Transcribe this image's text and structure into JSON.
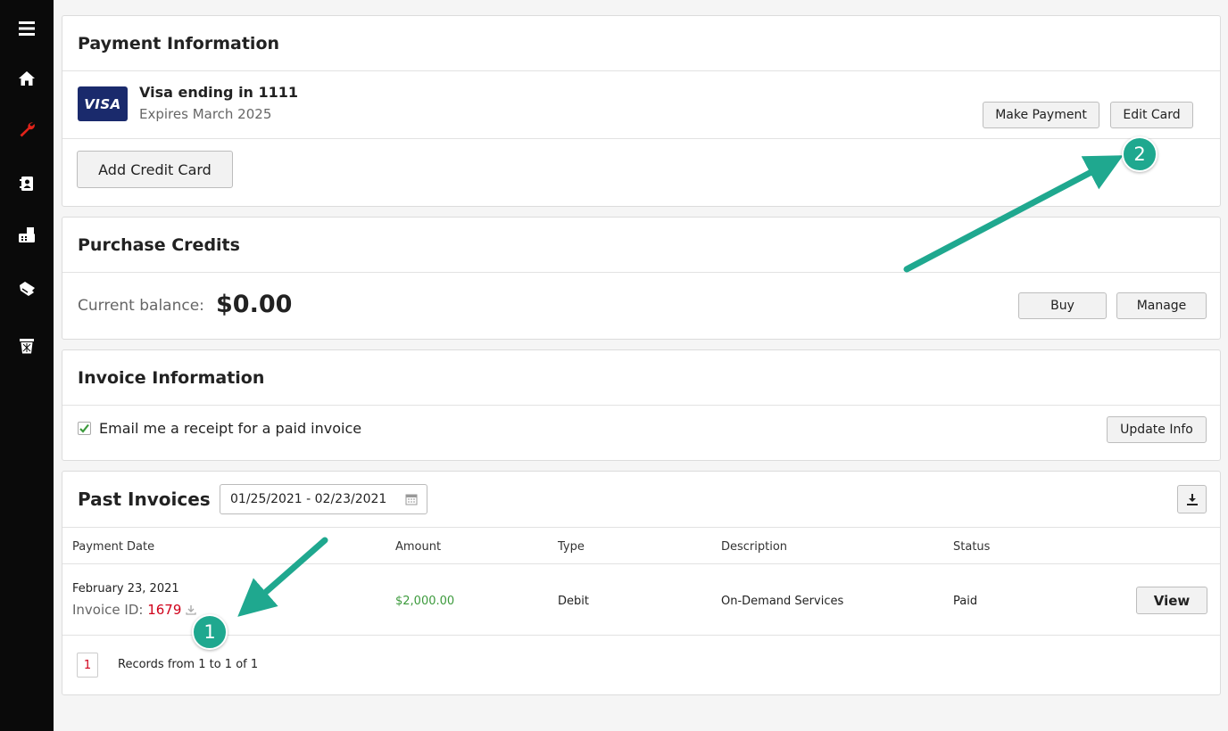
{
  "colors": {
    "accent": "#1fa88f",
    "invoice_id": "#d0021b",
    "amount": "#3c9a3c",
    "sidebar_bg": "#0a0a0a",
    "wrench": "#e2231a"
  },
  "sidebar": {
    "icons": [
      "menu-icon",
      "home-icon",
      "wrench-icon",
      "contacts-icon",
      "fax-icon",
      "handshake-icon",
      "trash-icon"
    ]
  },
  "payment": {
    "title": "Payment Information",
    "card_brand": "VISA",
    "card_name": "Visa ending in 1111",
    "card_expiry": "Expires March 2025",
    "make_payment_label": "Make Payment",
    "edit_card_label": "Edit Card",
    "add_card_label": "Add Credit Card"
  },
  "credits": {
    "title": "Purchase Credits",
    "balance_label": "Current balance:",
    "balance_value": "$0.00",
    "buy_label": "Buy",
    "manage_label": "Manage"
  },
  "invoice_info": {
    "title": "Invoice Information",
    "receipt_checkbox_label": "Email me a receipt for a paid invoice",
    "receipt_checked": true,
    "update_label": "Update Info"
  },
  "past_invoices": {
    "title": "Past Invoices",
    "date_range": "01/25/2021 - 02/23/2021",
    "columns": [
      "Payment Date",
      "Amount",
      "Type",
      "Description",
      "Status"
    ],
    "rows": [
      {
        "date": "February 23, 2021",
        "invoice_id_label": "Invoice ID:",
        "invoice_id": "1679",
        "amount": "$2,000.00",
        "type": "Debit",
        "description": "On-Demand Services",
        "status": "Paid",
        "view_label": "View"
      }
    ],
    "page_number": "1",
    "records_text": "Records from 1 to 1 of 1"
  },
  "callouts": {
    "first": "1",
    "second": "2"
  }
}
